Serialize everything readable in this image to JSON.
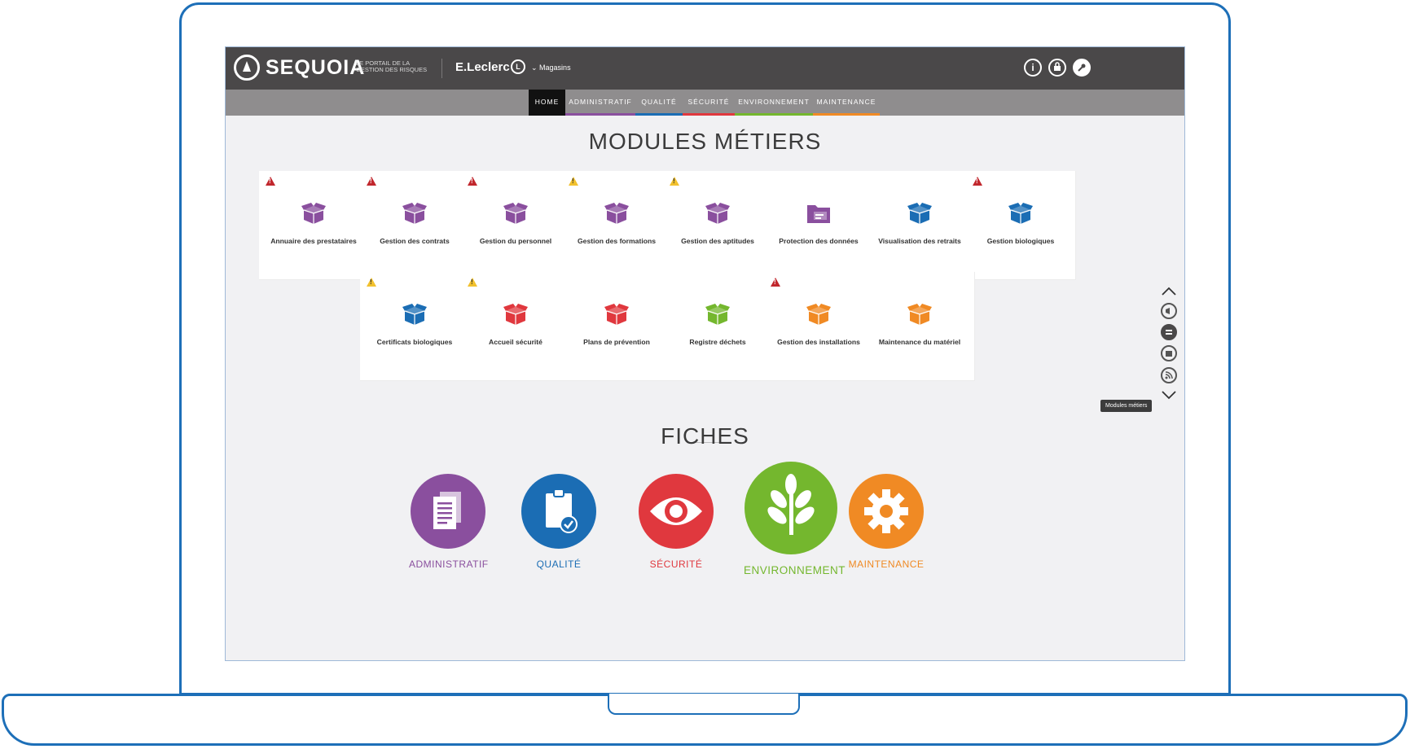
{
  "header": {
    "brand": "SEQUOIA",
    "tagline": "LE PORTAIL DE LA GESTION DES RISQUES",
    "client": "E.Leclerc",
    "client_badge": "L",
    "store_selector": "Magasins",
    "icons": [
      "info-icon",
      "lock-icon",
      "wrench-icon"
    ]
  },
  "nav": {
    "items": [
      {
        "label": "HOME",
        "color": "#111111"
      },
      {
        "label": "ADMINISTRATIF",
        "color": "#8a4f9e"
      },
      {
        "label": "QUALITÉ",
        "color": "#1b6db4"
      },
      {
        "label": "SÉCURITÉ",
        "color": "#e0383e"
      },
      {
        "label": "ENVIRONNEMENT",
        "color": "#74b72e"
      },
      {
        "label": "MAINTENANCE",
        "color": "#f08a24"
      }
    ]
  },
  "modules": {
    "title": "MODULES MÉTIERS",
    "items": [
      {
        "label": "Annuaire des prestataires",
        "color": "#8a4f9e",
        "warning": "red"
      },
      {
        "label": "Gestion des contrats",
        "color": "#8a4f9e",
        "warning": "red"
      },
      {
        "label": "Gestion du personnel",
        "color": "#8a4f9e",
        "warning": "red"
      },
      {
        "label": "Gestion des formations",
        "color": "#8a4f9e",
        "warning": "yellow"
      },
      {
        "label": "Gestion des aptitudes",
        "color": "#8a4f9e",
        "warning": "yellow"
      },
      {
        "label": "Protection des données",
        "color": "#8a4f9e",
        "warning": "none",
        "icon": "folder-icon"
      },
      {
        "label": "Visualisation des retraits",
        "color": "#1b6db4",
        "warning": "none"
      },
      {
        "label": "Gestion biologiques",
        "color": "#1b6db4",
        "warning": "red"
      },
      {
        "label": "Certificats biologiques",
        "color": "#1b6db4",
        "warning": "yellow"
      },
      {
        "label": "Accueil sécurité",
        "color": "#e0383e",
        "warning": "yellow"
      },
      {
        "label": "Plans de prévention",
        "color": "#e0383e",
        "warning": "none"
      },
      {
        "label": "Registre déchets",
        "color": "#74b72e",
        "warning": "none"
      },
      {
        "label": "Gestion des installations",
        "color": "#f08a24",
        "warning": "red"
      },
      {
        "label": "Maintenance du matériel",
        "color": "#f08a24",
        "warning": "none"
      }
    ]
  },
  "fiches": {
    "title": "FICHES",
    "items": [
      {
        "label": "ADMINISTRATIF",
        "color": "#8a4f9e",
        "icon": "document-icon"
      },
      {
        "label": "QUALITÉ",
        "color": "#1b6db4",
        "icon": "clipboard-check-icon"
      },
      {
        "label": "SÉCURITÉ",
        "color": "#e0383e",
        "icon": "eye-icon"
      },
      {
        "label": "ENVIRONNEMENT",
        "color": "#74b72e",
        "icon": "plant-icon"
      },
      {
        "label": "MAINTENANCE",
        "color": "#f08a24",
        "icon": "gear-icon"
      }
    ]
  },
  "side_nav": {
    "tooltip": "Modules métiers",
    "icons": [
      "chevron-up-icon",
      "megaphone-icon",
      "modules-icon",
      "cards-icon",
      "rss-icon",
      "chevron-down-icon"
    ]
  }
}
